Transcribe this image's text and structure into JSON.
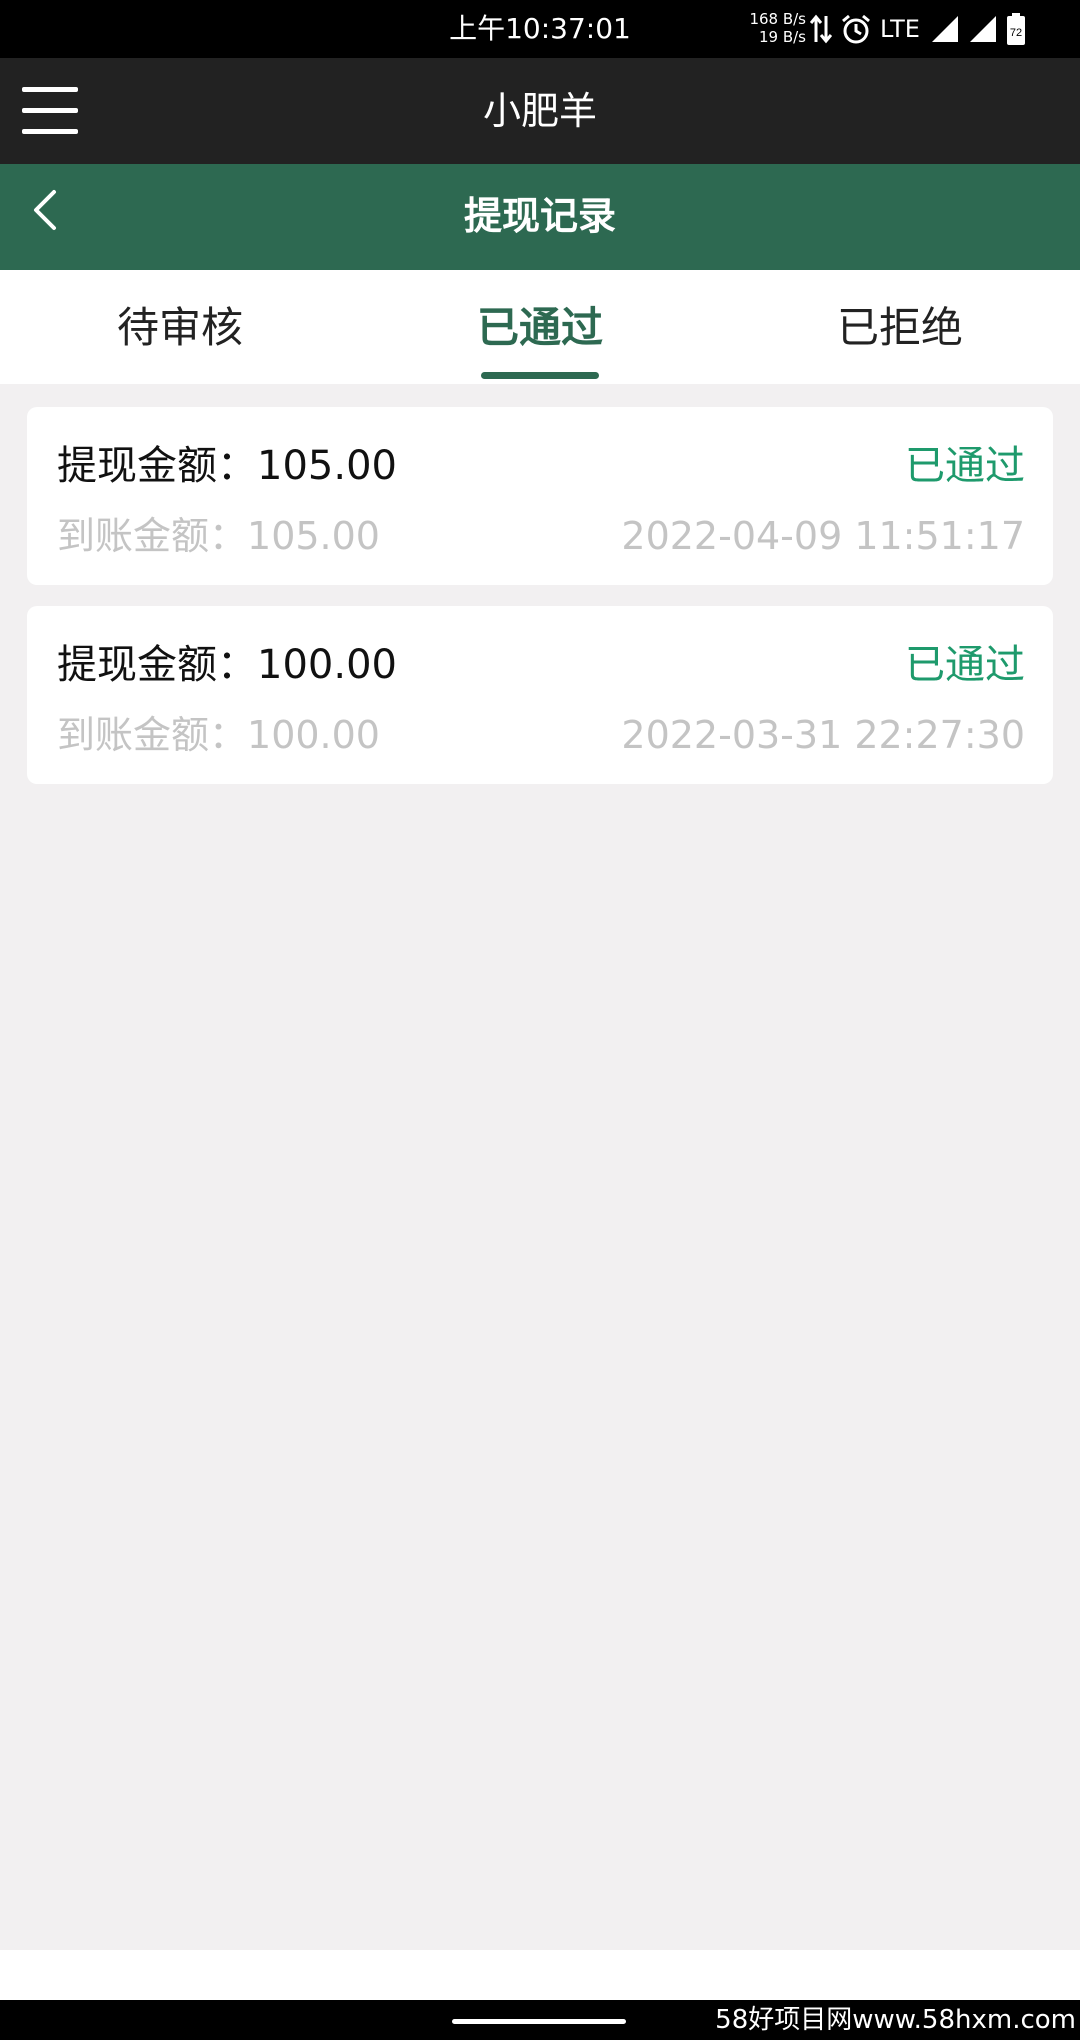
{
  "status_bar": {
    "time": "上午10:37:01",
    "speed_up": "168 B/s",
    "speed_down": "19 B/s",
    "network": "LTE",
    "battery": "72",
    "icons": [
      "data-transfer-icon",
      "alarm-icon",
      "signal-icon",
      "signal-icon",
      "battery-icon"
    ]
  },
  "app_bar": {
    "title": "小肥羊",
    "menu_icon": "menu-icon"
  },
  "header": {
    "title": "提现记录",
    "back_icon": "back-arrow-icon"
  },
  "tabs": [
    {
      "label": "待审核",
      "active": false
    },
    {
      "label": "已通过",
      "active": true
    },
    {
      "label": "已拒绝",
      "active": false
    }
  ],
  "records": [
    {
      "withdraw_label": "提现金额：",
      "withdraw_amount": "105.00",
      "status": "已通过",
      "received_label": "到账金额：",
      "received_amount": "105.00",
      "time": "2022-04-09 11:51:17"
    },
    {
      "withdraw_label": "提现金额：",
      "withdraw_amount": "100.00",
      "status": "已通过",
      "received_label": "到账金额：",
      "received_amount": "100.00",
      "time": "2022-03-31 22:27:30"
    }
  ],
  "watermark": "58好项目网www.58hxm.com",
  "colors": {
    "header_green": "#2d6951",
    "status_green": "#1e9a6c",
    "app_bar": "#222222",
    "background": "#f2f0f1"
  }
}
